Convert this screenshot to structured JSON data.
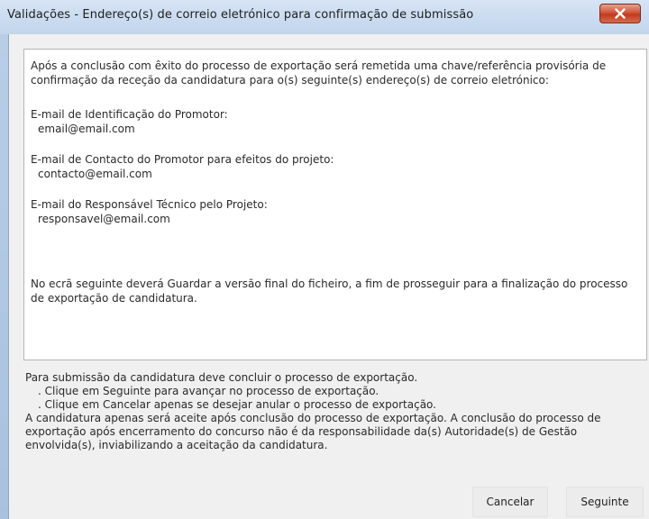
{
  "window": {
    "title": "Validações - Endereço(s) de correio eletrónico para confirmação de submissão"
  },
  "message": {
    "intro": "Após a conclusão com êxito do processo de exportação será remetida uma chave/referência provisória de confirmação da receção da candidatura para o(s) seguinte(s) endereço(s) de correio eletrónico:",
    "emails": [
      {
        "label": "E-mail de Identificação do Promotor:",
        "value": "email@email.com"
      },
      {
        "label": "E-mail de Contacto do Promotor para efeitos do projeto:",
        "value": "contacto@email.com"
      },
      {
        "label": "E-mail do Responsável Técnico pelo Projeto:",
        "value": "responsavel@email.com"
      }
    ],
    "closing": "No ecrã seguinte deverá Guardar a versão final do ficheiro, a fim de prosseguir para a finalização do processo de exportação de candidatura."
  },
  "footer": {
    "line1": "Para submissão da candidatura deve concluir o processo de exportação.",
    "bullet1": ". Clique em Seguinte para avançar no processo de exportação.",
    "bullet2": ". Clique em Cancelar apenas se desejar anular o processo de exportação.",
    "line2": "A candidatura apenas será aceite após conclusão do processo de exportação. A conclusão do processo de exportação após encerramento do concurso não é da responsabilidade da(s) Autoridade(s) de Gestão envolvida(s), inviabilizando a aceitação da candidatura."
  },
  "buttons": {
    "cancel": "Cancelar",
    "next": "Seguinte"
  },
  "colors": {
    "close_button": "#c9452a",
    "panel_background": "#ffffff",
    "dialog_background": "#f0f0f0"
  },
  "icons": {
    "close": "close-icon"
  }
}
